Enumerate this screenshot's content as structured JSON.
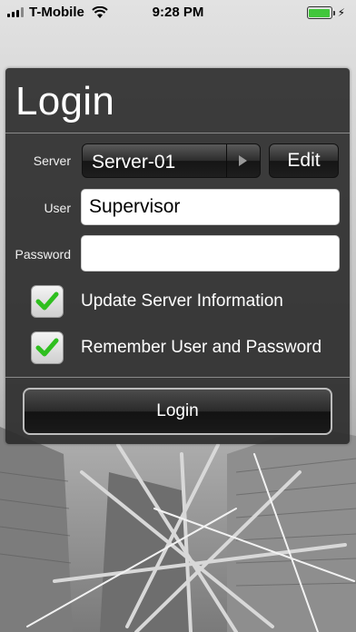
{
  "status_bar": {
    "carrier": "T-Mobile",
    "time": "9:28 PM",
    "battery_color": "#41c63b",
    "icons": [
      "signal-icon",
      "wifi-icon",
      "battery-icon",
      "charging-bolt-icon"
    ]
  },
  "login_panel": {
    "title": "Login",
    "server": {
      "label": "Server",
      "value": "Server-01",
      "edit_label": "Edit"
    },
    "user": {
      "label": "User",
      "value": "Supervisor"
    },
    "password": {
      "label": "Password",
      "value": ""
    },
    "options": [
      {
        "label": "Update Server Information",
        "checked": true
      },
      {
        "label": "Remember User and Password",
        "checked": true
      }
    ],
    "login_button_label": "Login"
  },
  "colors": {
    "panel_bg": "#2a2a2a",
    "check_green": "#2fbf1f"
  }
}
